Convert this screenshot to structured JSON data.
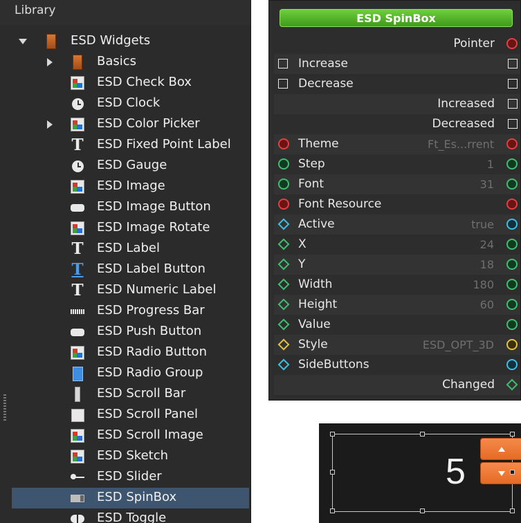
{
  "library": {
    "header": "Library",
    "tree": [
      {
        "label": "ESD Widgets",
        "icon": "book-icon",
        "expander": "expanded"
      },
      {
        "label": "Basics",
        "icon": "book-icon",
        "expander": "collapsed"
      },
      {
        "label": "ESD Check Box",
        "icon": "image-icon",
        "expander": "none"
      },
      {
        "label": "ESD Clock",
        "icon": "clock-icon",
        "expander": "none"
      },
      {
        "label": "ESD Color Picker",
        "icon": "image-icon",
        "expander": "collapsed"
      },
      {
        "label": "ESD Fixed Point Label",
        "icon": "text-icon",
        "expander": "none"
      },
      {
        "label": "ESD Gauge",
        "icon": "clock-icon",
        "expander": "none"
      },
      {
        "label": "ESD Image",
        "icon": "image-icon",
        "expander": "none"
      },
      {
        "label": "ESD Image Button",
        "icon": "button-icon",
        "expander": "none"
      },
      {
        "label": "ESD Image Rotate",
        "icon": "image-icon",
        "expander": "none"
      },
      {
        "label": "ESD Label",
        "icon": "text-icon",
        "expander": "none"
      },
      {
        "label": "ESD Label Button",
        "icon": "text-button-icon",
        "expander": "none"
      },
      {
        "label": "ESD Numeric Label",
        "icon": "text-icon",
        "expander": "none"
      },
      {
        "label": "ESD Progress Bar",
        "icon": "progress-bar-icon",
        "expander": "none"
      },
      {
        "label": "ESD Push Button",
        "icon": "button-icon",
        "expander": "none"
      },
      {
        "label": "ESD Radio Button",
        "icon": "image-icon",
        "expander": "none"
      },
      {
        "label": "ESD Radio Group",
        "icon": "radio-group-icon",
        "expander": "none"
      },
      {
        "label": "ESD Scroll Bar",
        "icon": "scroll-bar-icon",
        "expander": "none"
      },
      {
        "label": "ESD Scroll Panel",
        "icon": "scroll-panel-icon",
        "expander": "none"
      },
      {
        "label": "ESD Scroll Image",
        "icon": "image-icon",
        "expander": "none"
      },
      {
        "label": "ESD Sketch",
        "icon": "image-icon",
        "expander": "none"
      },
      {
        "label": "ESD Slider",
        "icon": "slider-icon",
        "expander": "none"
      },
      {
        "label": "ESD SpinBox",
        "icon": "spinbox-icon",
        "expander": "none",
        "selected": true
      },
      {
        "label": "ESD Toggle",
        "icon": "toggle-icon",
        "expander": "none"
      }
    ]
  },
  "node": {
    "title": "ESD SpinBox",
    "rows": [
      {
        "name": "",
        "right_label": "Pointer",
        "value": "",
        "in": "none",
        "out": "circle-red"
      },
      {
        "name": "Increase",
        "right_label": "",
        "value": "",
        "in": "square",
        "out": "square"
      },
      {
        "name": "Decrease",
        "right_label": "",
        "value": "",
        "in": "square",
        "out": "square"
      },
      {
        "name": "",
        "right_label": "Increased",
        "value": "",
        "in": "none",
        "out": "square"
      },
      {
        "name": "",
        "right_label": "Decreased",
        "value": "",
        "in": "none",
        "out": "square"
      },
      {
        "name": "Theme",
        "right_label": "",
        "value": "Ft_Es...rrent",
        "in": "circle-red",
        "out": "circle-red"
      },
      {
        "name": "Step",
        "right_label": "",
        "value": "1",
        "in": "circle-green",
        "out": "circle-green"
      },
      {
        "name": "Font",
        "right_label": "",
        "value": "31",
        "in": "circle-green",
        "out": "circle-green"
      },
      {
        "name": "Font Resource",
        "right_label": "",
        "value": "",
        "in": "circle-red",
        "out": "circle-red"
      },
      {
        "name": "Active",
        "right_label": "",
        "value": "true",
        "in": "diamond-cyan",
        "out": "circle-cyan"
      },
      {
        "name": "X",
        "right_label": "",
        "value": "24",
        "in": "diamond-green",
        "out": "circle-green"
      },
      {
        "name": "Y",
        "right_label": "",
        "value": "18",
        "in": "diamond-green",
        "out": "circle-green"
      },
      {
        "name": "Width",
        "right_label": "",
        "value": "180",
        "in": "diamond-green",
        "out": "circle-green"
      },
      {
        "name": "Height",
        "right_label": "",
        "value": "60",
        "in": "diamond-green",
        "out": "circle-green"
      },
      {
        "name": "Value",
        "right_label": "",
        "value": "",
        "in": "diamond-green",
        "out": "circle-green"
      },
      {
        "name": "Style",
        "right_label": "",
        "value": "ESD_OPT_3D",
        "in": "diamond-yellow",
        "out": "circle-yellow"
      },
      {
        "name": "SideButtons",
        "right_label": "",
        "value": "",
        "in": "diamond-cyan",
        "out": "circle-cyan"
      },
      {
        "name": "",
        "right_label": "Changed",
        "value": "",
        "in": "none",
        "out": "diamond-green"
      }
    ]
  },
  "preview": {
    "value": "5",
    "colors": {
      "button": "#ef7a35",
      "background": "#1b1b1b"
    }
  }
}
